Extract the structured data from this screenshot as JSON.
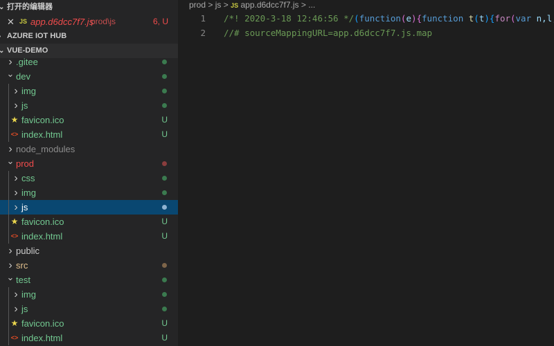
{
  "sidebar": {
    "open_editors_title": "打开的编辑器",
    "open_editor": {
      "name": "app.d6dcc7f7.js",
      "path": "prod\\js",
      "badge": "6, U",
      "icon": "JS"
    },
    "azure_title": "AZURE IOT HUB",
    "project_title": "VUE-DEMO",
    "tree": [
      {
        "label": ".gitee",
        "depth": 0,
        "kind": "folder",
        "open": false,
        "color": "#73c991",
        "status": "dot",
        "dot": "#3b7a4f"
      },
      {
        "label": "dev",
        "depth": 0,
        "kind": "folder",
        "open": true,
        "color": "#73c991",
        "status": "dot",
        "dot": "#3b7a4f"
      },
      {
        "label": "img",
        "depth": 1,
        "kind": "folder",
        "open": false,
        "color": "#73c991",
        "status": "dot",
        "dot": "#3b7a4f"
      },
      {
        "label": "js",
        "depth": 1,
        "kind": "folder",
        "open": false,
        "color": "#73c991",
        "status": "dot",
        "dot": "#3b7a4f"
      },
      {
        "label": "favicon.ico",
        "depth": 1,
        "kind": "favicon",
        "color": "#73c991",
        "status": "U"
      },
      {
        "label": "index.html",
        "depth": 1,
        "kind": "html",
        "color": "#73c991",
        "status": "U"
      },
      {
        "label": "node_modules",
        "depth": 0,
        "kind": "folder",
        "open": false,
        "color": "#8c8c8c",
        "status": ""
      },
      {
        "label": "prod",
        "depth": 0,
        "kind": "folder",
        "open": true,
        "color": "#f14c4c",
        "status": "dot",
        "dot": "#8a3d3d"
      },
      {
        "label": "css",
        "depth": 1,
        "kind": "folder",
        "open": false,
        "color": "#73c991",
        "status": "dot",
        "dot": "#3b7a4f"
      },
      {
        "label": "img",
        "depth": 1,
        "kind": "folder",
        "open": false,
        "color": "#73c991",
        "status": "dot",
        "dot": "#3b7a4f"
      },
      {
        "label": "js",
        "depth": 1,
        "kind": "folder",
        "open": false,
        "color": "#ffffff",
        "status": "dot",
        "dot": "#8fb3d1",
        "selected": true
      },
      {
        "label": "favicon.ico",
        "depth": 1,
        "kind": "favicon",
        "color": "#73c991",
        "status": "U"
      },
      {
        "label": "index.html",
        "depth": 1,
        "kind": "html",
        "color": "#73c991",
        "status": "U"
      },
      {
        "label": "public",
        "depth": 0,
        "kind": "folder",
        "open": false,
        "color": "#cccccc",
        "status": ""
      },
      {
        "label": "src",
        "depth": 0,
        "kind": "folder",
        "open": false,
        "color": "#e2c08d",
        "status": "dot",
        "dot": "#7d6449"
      },
      {
        "label": "test",
        "depth": 0,
        "kind": "folder",
        "open": true,
        "color": "#73c991",
        "status": "dot",
        "dot": "#3b7a4f"
      },
      {
        "label": "img",
        "depth": 1,
        "kind": "folder",
        "open": false,
        "color": "#73c991",
        "status": "dot",
        "dot": "#3b7a4f"
      },
      {
        "label": "js",
        "depth": 1,
        "kind": "folder",
        "open": false,
        "color": "#73c991",
        "status": "dot",
        "dot": "#3b7a4f"
      },
      {
        "label": "favicon.ico",
        "depth": 1,
        "kind": "favicon",
        "color": "#73c991",
        "status": "U"
      },
      {
        "label": "index.html",
        "depth": 1,
        "kind": "html",
        "color": "#73c991",
        "status": "U"
      }
    ]
  },
  "breadcrumb": {
    "parts": [
      "prod",
      "js"
    ],
    "file": "app.d6dcc7f7.js",
    "more": "...",
    "sep": ">",
    "icon": "JS"
  },
  "editor": {
    "lines": [
      {
        "num": "1",
        "tokens": [
          {
            "t": "/*! 2020-3-18 12:46:56 */",
            "c": "cm"
          },
          {
            "t": "(",
            "c": "pb"
          },
          {
            "t": "function",
            "c": "kw"
          },
          {
            "t": "(",
            "c": "br"
          },
          {
            "t": "e",
            "c": "id"
          },
          {
            "t": ")",
            "c": "br"
          },
          {
            "t": "{",
            "c": "br"
          },
          {
            "t": "function ",
            "c": "kw"
          },
          {
            "t": "t",
            "c": "fn"
          },
          {
            "t": "(",
            "c": "pb"
          },
          {
            "t": "t",
            "c": "id"
          },
          {
            "t": ")",
            "c": "pb"
          },
          {
            "t": "{",
            "c": "pb"
          },
          {
            "t": "for",
            "c": "ctl"
          },
          {
            "t": "(",
            "c": "br"
          },
          {
            "t": "var ",
            "c": "kw"
          },
          {
            "t": "n,l,u",
            "c": "id"
          }
        ]
      },
      {
        "num": "2",
        "tokens": [
          {
            "t": "//# sourceMappingURL=app.d6dcc7f7.js.map",
            "c": "cm"
          }
        ]
      }
    ]
  }
}
